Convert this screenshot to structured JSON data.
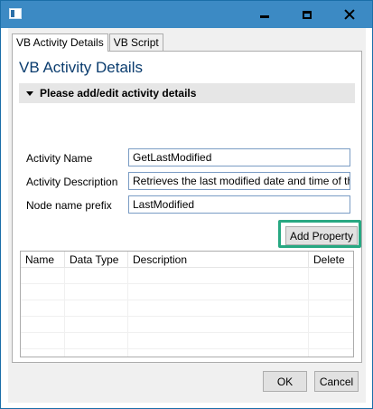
{
  "window": {
    "title_icon": "app-window-icon",
    "controls": {
      "minimize": "minimize-icon",
      "maximize": "maximize-icon",
      "close": "close-icon"
    }
  },
  "tabs": [
    {
      "label": "VB Activity Details",
      "active": true
    },
    {
      "label": "VB Script",
      "active": false
    }
  ],
  "page_title": "VB Activity Details",
  "section": {
    "header": "Please add/edit activity details",
    "icon": "collapse-arrow-icon"
  },
  "fields": {
    "activity_name": {
      "label": "Activity Name",
      "value": "GetLastModified"
    },
    "activity_description": {
      "label": "Activity Description",
      "value": "Retrieves the last modified date and time of th"
    },
    "node_name_prefix": {
      "label": "Node name prefix",
      "value": "LastModified"
    }
  },
  "add_property_label": "Add Property",
  "grid": {
    "columns": [
      "Name",
      "Data Type",
      "Description",
      "Delete"
    ]
  },
  "footer": {
    "ok_label": "OK",
    "cancel_label": "Cancel"
  },
  "colors": {
    "titlebar": "#3c8ac4",
    "highlight": "#27a882",
    "title_text": "#0a3c6e"
  }
}
